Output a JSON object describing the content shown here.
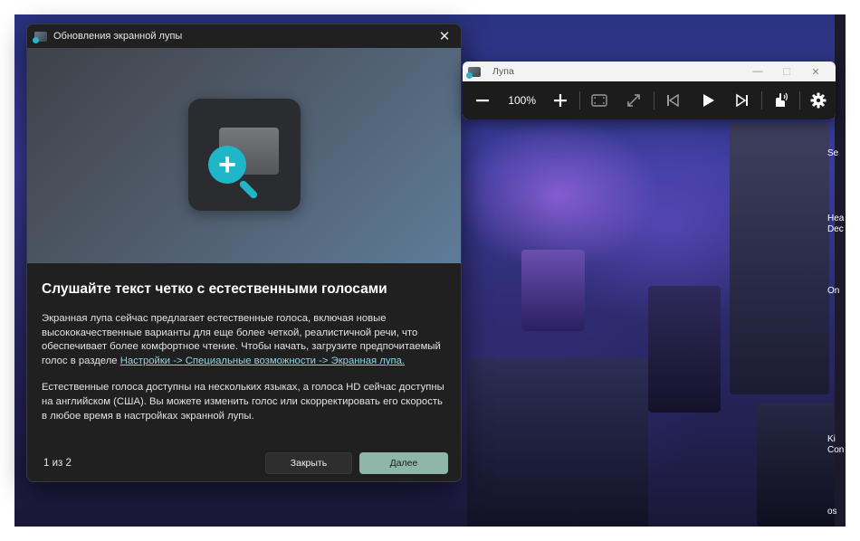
{
  "dialog": {
    "title": "Обновления экранной лупы",
    "heading": "Слушайте текст четко с естественными голосами",
    "paragraph1_text": "Экранная лупа сейчас предлагает естественные голоса, включая новые высококачественные варианты для еще более четкой, реалистичной речи, что обеспечивает более комфортное чтение. Чтобы начать, загрузите предпочитаемый голос в разделе ",
    "paragraph1_link": "Настройки -> Специальные возможности -> Экранная лупа.",
    "paragraph2": "Естественные голоса доступны на нескольких языках, а голоса HD сейчас доступны на английском (США). Вы можете изменить голос или скорректировать его скорость в любое время в настройках экранной лупы.",
    "pager": "1 из 2",
    "close_label": "Закрыть",
    "next_label": "Далее",
    "close_icon": "✕",
    "accent_color": "#8fb6ab",
    "link_color": "#8fd4e6"
  },
  "magnifier": {
    "title": "Лупа",
    "zoom_level": "100%",
    "icons": {
      "zoom_out": "minus-icon",
      "zoom_in": "plus-icon",
      "view": "fullscreen-view-icon",
      "resize": "resize-icon",
      "prev": "previous-icon",
      "play": "play-icon",
      "next": "next-icon",
      "read": "read-from-here-icon",
      "settings": "gear-icon"
    }
  },
  "desktop": {
    "edge_labels": [
      "Se",
      "Hea",
      "Dec",
      "On",
      "Ki",
      "Con",
      "os"
    ]
  }
}
